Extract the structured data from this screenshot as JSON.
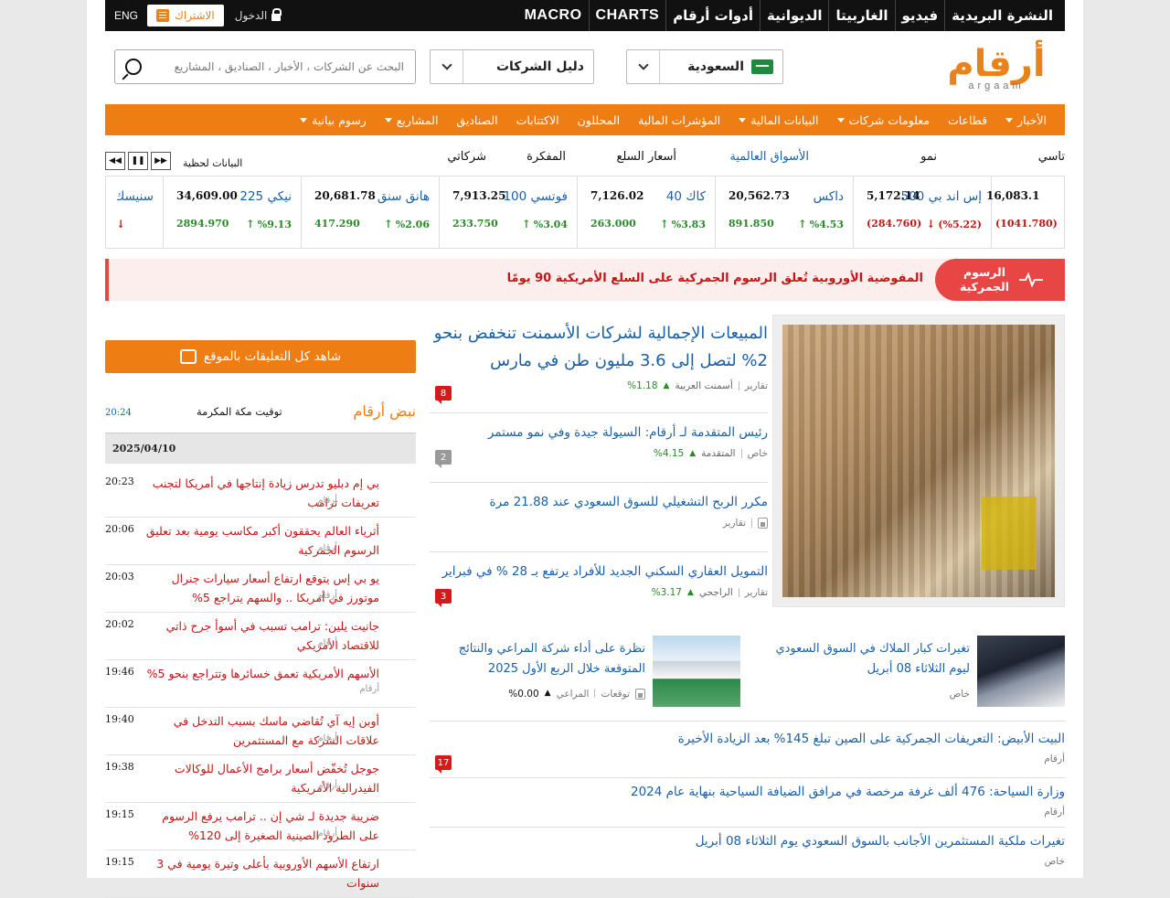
{
  "topbar": {
    "nav": [
      {
        "label": "MACRO",
        "en": true
      },
      {
        "label": "CHARTS",
        "en": true
      },
      {
        "label": "أدوات أرقام"
      },
      {
        "label": "الديوانية"
      },
      {
        "label": "الغاربيتا"
      },
      {
        "label": "فيديو"
      },
      {
        "label": "النشرة البريدية"
      }
    ],
    "eng": "ENG",
    "subscribe": "الاشتراك",
    "login": "الدخول"
  },
  "header": {
    "logo_ar": "أرقام",
    "logo_en": "argaam",
    "market_select": "السعودية",
    "directory_select": "دليل الشركات",
    "search_placeholder": "البحث عن الشركات ، الأخبار ، الصناديق ، المشاريع"
  },
  "mainnav": [
    {
      "label": "الأخبار",
      "caret": true
    },
    {
      "label": "قطاعات",
      "caret": false
    },
    {
      "label": "معلومات شركات",
      "caret": true
    },
    {
      "label": "البيانات المالية",
      "caret": true
    },
    {
      "label": "المؤشرات المالية",
      "caret": false
    },
    {
      "label": "المحللون",
      "caret": false
    },
    {
      "label": "الاكتتابات",
      "caret": false
    },
    {
      "label": "الصناديق",
      "caret": false
    },
    {
      "label": "المشاريع",
      "caret": true
    },
    {
      "label": "رسوم بيانية",
      "caret": true
    }
  ],
  "markettabs": {
    "tabs": [
      "تاسي",
      "نمو",
      "الأسواق العالمية",
      "أسعار السلع",
      "المفكرة",
      "شركاتي"
    ],
    "active": "الأسواق العالمية",
    "live_label": "البيانات لحظية"
  },
  "ticker": [
    {
      "name": "",
      "value": "16,083.1",
      "change": "(1041.780)",
      "pct": "",
      "dir": "dn"
    },
    {
      "name": "إس اند بي 500",
      "value": "5,172.14",
      "change": "(284.760)",
      "pct": "(%5.22)",
      "dir": "dn"
    },
    {
      "name": "داكس",
      "value": "20,562.73",
      "change": "891.850",
      "pct": "%4.53",
      "dir": "up"
    },
    {
      "name": "كاك 40",
      "value": "7,126.02",
      "change": "263.000",
      "pct": "%3.83",
      "dir": "up"
    },
    {
      "name": "فوتسي 100",
      "value": "7,913.25",
      "change": "233.750",
      "pct": "%3.04",
      "dir": "up"
    },
    {
      "name": "هانق سنق",
      "value": "20,681.78",
      "change": "417.290",
      "pct": "%2.06",
      "dir": "up"
    },
    {
      "name": "نيكي 225",
      "value": "34,609.00",
      "change": "2894.970",
      "pct": "%9.13",
      "dir": "up"
    },
    {
      "name": "سنيسك",
      "value": "",
      "change": "",
      "pct": "",
      "dir": "dn"
    }
  ],
  "banner": {
    "badge": "الرسوم الجمركية",
    "text": "المفوضية الأوروبية تُعلق الرسوم الجمركية على السلع الأمريكية 90 يومًا"
  },
  "feature": {
    "headline": "المبيعات الإجمالية لشركات الأسمنت تنخفض بنحو 2% لتصل إلى 3.6 مليون طن في مارس",
    "category": "تقارير",
    "company": "أسمنت العربية",
    "pct": "%1.18",
    "comments": "8"
  },
  "news": [
    {
      "headline": "رئيس المتقدمة لـ أرقام: السيولة جيدة وفي نمو مستمر",
      "category": "خاص",
      "company": "المتقدمة",
      "pct": "%4.15",
      "comments": "2",
      "comment_color": "gray"
    },
    {
      "headline": "مكرر الربح التشغيلي للسوق السعودي عند 21.88 مرة",
      "category": "تقارير",
      "company": "",
      "pct": "",
      "comments": "",
      "locked": true
    },
    {
      "headline": "التمويل العقاري السكني الجديد للأفراد يرتفع بـ 28 % في فبراير",
      "category": "تقارير",
      "company": "الراجحي",
      "pct": "%3.17",
      "comments": "3",
      "comment_color": "red"
    }
  ],
  "cards": [
    {
      "title": "تغيرات كبار الملاك في السوق السعودي ليوم الثلاثاء 08 أبريل",
      "category": "خاص"
    },
    {
      "title": "نظرة على أداء شركة المراعي والنتائج المتوقعة خلال الربع الأول 2025",
      "category": "توقعات",
      "company": "المراعي",
      "pct": "%0.00"
    }
  ],
  "lower_news": [
    {
      "headline": "البيت الأبيض: التعريفات الجمركية على الصين تبلغ 145% بعد الزيادة الأخيرة",
      "source": "أرقام",
      "comments": "17"
    },
    {
      "headline": "وزارة السياحة: 476 ألف غرفة مرخصة في مرافق الضيافة السياحية بنهاية عام 2024",
      "source": "أرقام"
    },
    {
      "headline": "تغيرات ملكية المستثمرين الأجانب بالسوق السعودي يوم الثلاثاء 08 أبريل",
      "source": "خاص"
    }
  ],
  "sidebar": {
    "comments_btn": "شاهد كل التعليقات بالموقع",
    "pulse_title": "نبض أرقام",
    "mecca_label": "توقيت مكة المكرمة",
    "mecca_time": "20:24",
    "date": "2025/04/10",
    "feed": [
      {
        "time": "20:23",
        "text": "بي إم دبليو تدرس زيادة إنتاجها في أمريكا لتجنب تعريفات ترامب",
        "source": "أرقام"
      },
      {
        "time": "20:06",
        "text": "أثرياء العالم يحققون أكبر مكاسب يومية بعد تعليق الرسوم الجمركية",
        "source": "أرقام"
      },
      {
        "time": "20:03",
        "text": "يو بي إس يتوقع ارتفاع أسعار سيارات جنرال موتورز في أمريكا .. والسهم يتراجع 5%",
        "source": "أرقام"
      },
      {
        "time": "20:02",
        "text": "جانيت يلين: ترامب تسبب في أسوأ جرح ذاتي للاقتصاد الأمريكي",
        "source": "أرقام"
      },
      {
        "time": "19:46",
        "text": "الأسهم الأمريكية تعمق خسائرها وتتراجع بنحو 5%",
        "source": "أرقام"
      },
      {
        "time": "19:40",
        "text": "أوبن إيه آي تُقاضي ماسك بسبب التدخل في علاقات الشركة مع المستثمرين",
        "source": "أرقام"
      },
      {
        "time": "19:38",
        "text": "جوجل تُخفّض أسعار برامج الأعمال للوكالات الفيدرالية الأمريكية",
        "source": "أرقام"
      },
      {
        "time": "19:15",
        "text": "ضريبة جديدة لـ شي إن .. ترامب يرفع الرسوم على الطرود الصينية الصغيرة إلى 120%",
        "source": "أرقام"
      },
      {
        "time": "19:15",
        "text": "ارتفاع الأسهم الأوروبية بأعلى وتيرة يومية في 3 سنوات",
        "source": ""
      }
    ]
  }
}
